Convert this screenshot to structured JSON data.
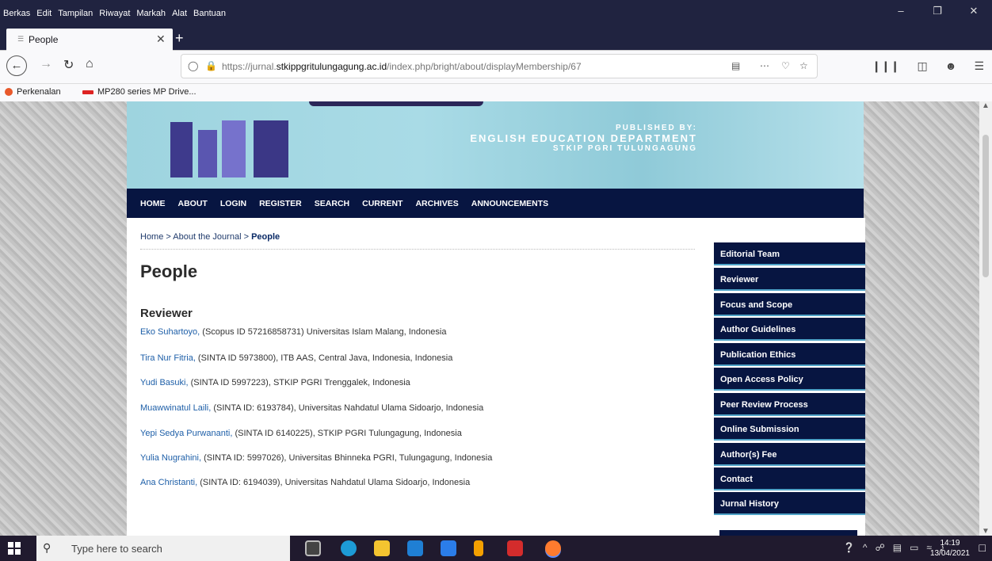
{
  "browser": {
    "menu": [
      "Berkas",
      "Edit",
      "Tampilan",
      "Riwayat",
      "Markah",
      "Alat",
      "Bantuan"
    ],
    "tab_title": "People",
    "url_prefix": "https://jurnal.",
    "url_domain": "stkippgritulungagung.ac.id",
    "url_path": "/index.php/bright/about/displayMembership/67",
    "bookmarks": [
      "Perkenalan",
      "MP280 series MP Drive..."
    ]
  },
  "banner": {
    "published_by": "PUBLISHED BY:",
    "department": "ENGLISH EDUCATION DEPARTMENT",
    "institution": "STKIP PGRI TULUNGAGUNG"
  },
  "nav": [
    "HOME",
    "ABOUT",
    "LOGIN",
    "REGISTER",
    "SEARCH",
    "CURRENT",
    "ARCHIVES",
    "ANNOUNCEMENTS"
  ],
  "breadcrumb": {
    "home": "Home",
    "sep": " > ",
    "about": "About the Journal",
    "current": "People"
  },
  "page_title": "People",
  "section_title": "Reviewer",
  "reviewers": [
    {
      "name": "Eko Suhartoyo,",
      "detail": " (Scopus ID 57216858731) Universitas Islam Malang, Indonesia"
    },
    {
      "name": "Tira Nur Fitria,",
      "detail": " (SINTA ID 5973800), ITB AAS, Central Java, Indonesia, Indonesia"
    },
    {
      "name": "Yudi Basuki,",
      "detail": " (SINTA ID 5997223), STKIP PGRI Trenggalek, Indonesia"
    },
    {
      "name": "Muawwinatul Laili,",
      "detail": " (SINTA ID: 6193784), Universitas Nahdatul Ulama Sidoarjo, Indonesia"
    },
    {
      "name": "Yepi Sedya Purwananti,",
      "detail": " (SINTA ID 6140225), STKIP PGRI Tulungagung, Indonesia"
    },
    {
      "name": "Yulia Nugrahini,",
      "detail": " (SINTA ID: 5997026), Universitas Bhinneka PGRI, Tulungagung, Indonesia"
    },
    {
      "name": "Ana Christanti,",
      "detail": " (SINTA ID: 6194039), Universitas Nahdatul Ulama Sidoarjo, Indonesia"
    }
  ],
  "sidebar": [
    "Editorial Team",
    "Reviewer",
    "Focus and Scope",
    "Author Guidelines",
    "Publication Ethics",
    "Open Access Policy",
    "Peer Review Process",
    "Online Submission",
    "Author(s) Fee",
    "Contact",
    "Jurnal History"
  ],
  "taskbar": {
    "search_placeholder": "Type here to search",
    "time": "14:19",
    "date": "13/04/2021"
  },
  "colors": {
    "nav_bg": "#071541",
    "link": "#1e5fa8",
    "banner_bg": "#9ed4df"
  }
}
